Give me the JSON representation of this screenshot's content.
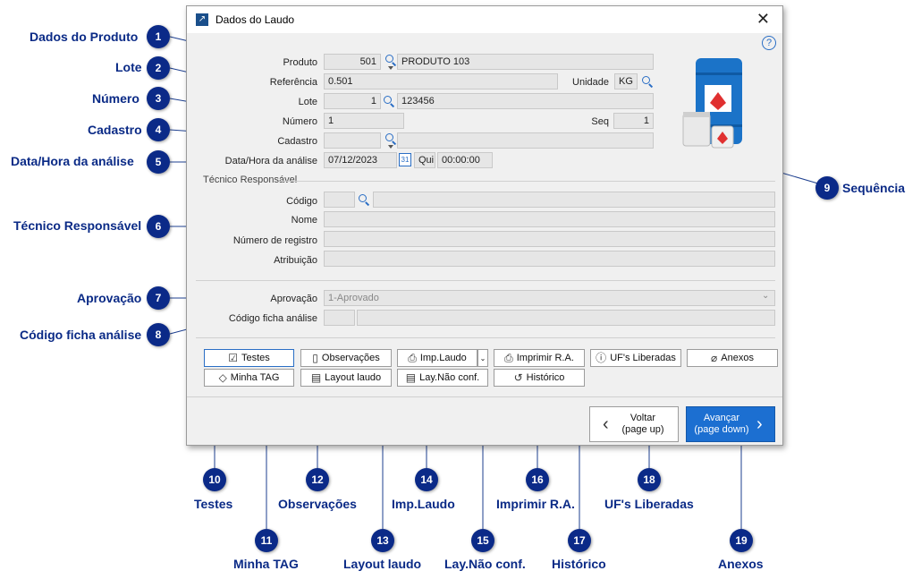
{
  "window": {
    "title": "Dados do Laudo",
    "help": "?",
    "close": "✕"
  },
  "form": {
    "produto_label": "Produto",
    "produto_code": "501",
    "produto_name": "PRODUTO 103",
    "referencia_label": "Referência",
    "referencia_value": "0.501",
    "unidade_label": "Unidade",
    "unidade_value": "KG",
    "lote_label": "Lote",
    "lote_code": "1",
    "lote_name": "123456",
    "numero_label": "Número",
    "numero_value": "1",
    "seq_label": "Seq",
    "seq_value": "1",
    "cadastro_label": "Cadastro",
    "cadastro_code": "",
    "cadastro_name": "",
    "datahora_label": "Data/Hora da análise",
    "data_value": "07/12/2023",
    "dia_value": "Qui",
    "hora_value": "00:00:00",
    "tecnico_section": "Técnico Responsável",
    "codigo_label": "Código",
    "codigo_value": "",
    "codigo_name": "",
    "nome_label": "Nome",
    "nome_value": "",
    "registro_label": "Número de registro",
    "registro_value": "",
    "atribuicao_label": "Atribuição",
    "atribuicao_value": "",
    "aprovacao_label": "Aprovação",
    "aprovacao_value": "1-Aprovado",
    "codigo_ficha_label": "Código ficha análise",
    "codigo_ficha_code": "",
    "codigo_ficha_name": ""
  },
  "buttons": {
    "testes": "Testes",
    "minha_tag": "Minha TAG",
    "observacoes": "Observações",
    "layout_laudo": "Layout laudo",
    "imp_laudo": "Imp.Laudo",
    "lay_nao_conf": "Lay.Não conf.",
    "imprimir_ra": "Imprimir R.A.",
    "historico": "Histórico",
    "ufs_liberadas": "UF's Liberadas",
    "anexos": "Anexos",
    "voltar_line1": "Voltar",
    "voltar_line2": "(page up)",
    "avancar_line1": "Avançar",
    "avancar_line2": "(page down)"
  },
  "callouts": [
    {
      "n": "1",
      "label": "Dados do Produto"
    },
    {
      "n": "2",
      "label": "Lote"
    },
    {
      "n": "3",
      "label": "Número"
    },
    {
      "n": "4",
      "label": "Cadastro"
    },
    {
      "n": "5",
      "label": "Data/Hora da análise"
    },
    {
      "n": "6",
      "label": "Técnico Responsável"
    },
    {
      "n": "7",
      "label": "Aprovação"
    },
    {
      "n": "8",
      "label": "Código ficha análise"
    },
    {
      "n": "9",
      "label": "Sequência"
    },
    {
      "n": "10",
      "label": "Testes"
    },
    {
      "n": "11",
      "label": "Minha TAG"
    },
    {
      "n": "12",
      "label": "Observações"
    },
    {
      "n": "13",
      "label": "Layout laudo"
    },
    {
      "n": "14",
      "label": "Imp.Laudo"
    },
    {
      "n": "15",
      "label": "Lay.Não conf."
    },
    {
      "n": "16",
      "label": "Imprimir R.A."
    },
    {
      "n": "17",
      "label": "Histórico"
    },
    {
      "n": "18",
      "label": "UF's Liberadas"
    },
    {
      "n": "19",
      "label": "Anexos"
    }
  ],
  "colors": {
    "badge": "#0b2a88",
    "accent": "#1c6fd1"
  }
}
